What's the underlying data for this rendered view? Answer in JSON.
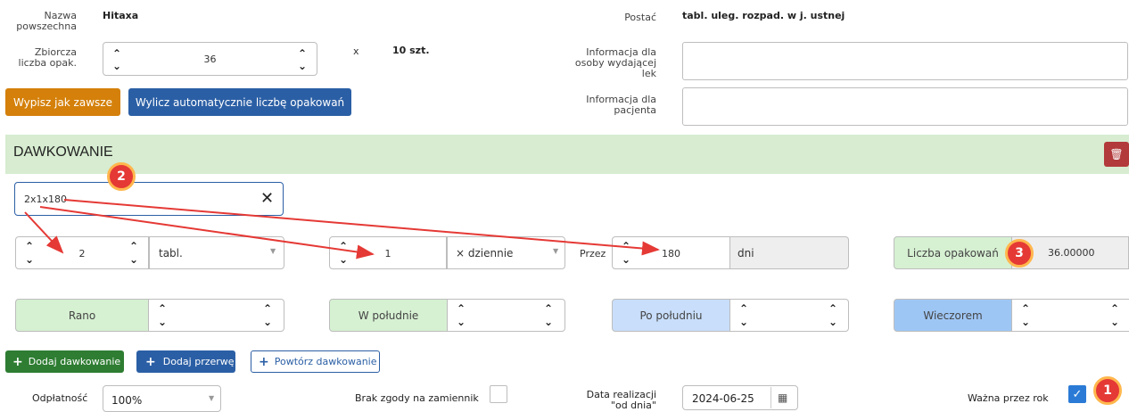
{
  "top": {
    "name_label": "Nazwa powszechna",
    "name_value": "Hitaxa",
    "form_label": "Postać",
    "form_value": "tabl. uleg. rozpad. w j. ustnej",
    "collective_label": "Zbiorcza liczba opak.",
    "collective_value": "36",
    "times": "x",
    "pack_size": "10 szt.",
    "info_dispenser_label": "Informacja dla osoby wydającej lek",
    "info_patient_label": "Informacja dla pacjenta",
    "btn_always": "Wypisz jak zawsze",
    "btn_auto": "Wylicz automatycznie liczbę opakowań"
  },
  "dosage": {
    "title": "DAWKOWANIE",
    "pattern": "2x1x180",
    "qty": "2",
    "unit": "tabl.",
    "freq": "1",
    "freq_unit": "× dziennie",
    "for_label": "Przez",
    "days_value": "180",
    "days_unit": "dni",
    "packs_label": "Liczba opakowań",
    "packs_value": "36.00000",
    "morning": "Rano",
    "noon": "W południe",
    "afternoon": "Po południu",
    "evening": "Wieczorem"
  },
  "actions": {
    "add_dose": "Dodaj dawkowanie",
    "add_break": "Dodaj przerwę",
    "repeat": "Powtórz dawkowanie"
  },
  "bottom": {
    "payment_label": "Odpłatność",
    "payment_value": "100%",
    "no_sub_label": "Brak zgody na zamiennik",
    "date_label": "Data realizacji \"od dnia\"",
    "date_value": "2024-06-25",
    "valid_label": "Ważna przez rok"
  },
  "badges": [
    "1",
    "2",
    "3"
  ],
  "colors": {
    "orange": "#d4800a",
    "blue": "#2b5fa5",
    "green": "#2e7d32",
    "section_bg": "#dff0d8",
    "seg_green": "#d6f0d2",
    "seg_blue": "#c8defa",
    "seg_blue_dark": "#9ec6f5",
    "badge_red": "#e53935",
    "delete_red": "#b23a3a"
  }
}
